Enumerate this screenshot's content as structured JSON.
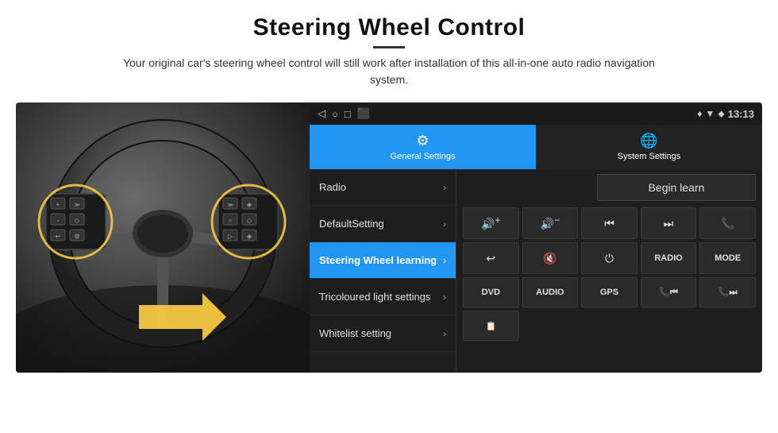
{
  "page": {
    "title": "Steering Wheel Control",
    "divider": true,
    "subtitle": "Your original car's steering wheel control will still work after installation of this all-in-one auto radio navigation system."
  },
  "status_bar": {
    "time": "13:13",
    "icons_left": [
      "◁",
      "○",
      "□",
      "⬛"
    ],
    "icons_right": [
      "♦",
      "▼",
      "⬥"
    ]
  },
  "tabs": [
    {
      "label": "General Settings",
      "icon": "⚙",
      "active": true
    },
    {
      "label": "System Settings",
      "icon": "🌐",
      "active": false
    }
  ],
  "menu_items": [
    {
      "label": "Radio",
      "active": false
    },
    {
      "label": "DefaultSetting",
      "active": false
    },
    {
      "label": "Steering Wheel learning",
      "active": true
    },
    {
      "label": "Tricoloured light settings",
      "active": false
    },
    {
      "label": "Whitelist setting",
      "active": false
    }
  ],
  "controls": {
    "begin_learn": "Begin learn",
    "row1": [
      {
        "icon": "🔊+",
        "type": "icon"
      },
      {
        "icon": "🔊-",
        "type": "icon"
      },
      {
        "icon": "⏮",
        "type": "icon"
      },
      {
        "icon": "⏭",
        "type": "icon"
      },
      {
        "icon": "📞",
        "type": "icon"
      }
    ],
    "row2": [
      {
        "icon": "↩",
        "type": "icon"
      },
      {
        "icon": "🔇",
        "type": "icon"
      },
      {
        "icon": "⏻",
        "type": "icon"
      },
      {
        "label": "RADIO",
        "type": "text"
      },
      {
        "label": "MODE",
        "type": "text"
      }
    ],
    "row3": [
      {
        "label": "DVD",
        "type": "text"
      },
      {
        "label": "AUDIO",
        "type": "text"
      },
      {
        "label": "GPS",
        "type": "text"
      },
      {
        "icon": "📞⏮",
        "type": "icon"
      },
      {
        "icon": "📞⏭",
        "type": "icon"
      }
    ],
    "row4": [
      {
        "icon": "📋",
        "type": "icon"
      }
    ]
  }
}
